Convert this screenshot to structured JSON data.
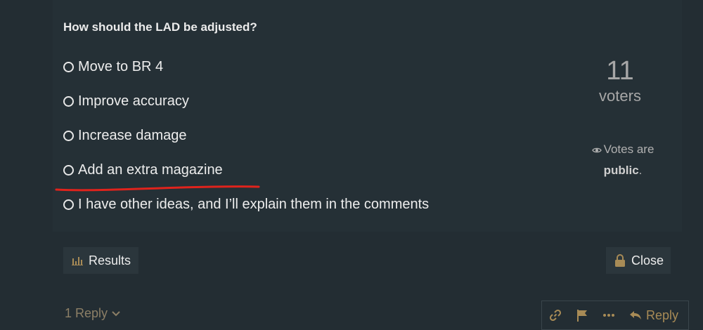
{
  "poll": {
    "question": "How should the LAD be adjusted?",
    "options": [
      {
        "label": "Move to BR 4"
      },
      {
        "label": "Improve accuracy"
      },
      {
        "label": "Increase damage"
      },
      {
        "label": "Add an extra magazine"
      },
      {
        "label": "I have other ideas, and I’ll explain them in the comments"
      }
    ],
    "voters_count": "11",
    "voters_label": "voters",
    "visibility_prefix": "Votes are",
    "visibility_value": "public",
    "visibility_suffix": ".",
    "results_label": "Results",
    "close_label": "Close"
  },
  "footer": {
    "replies_label": "1 Reply",
    "reply_label": "Reply"
  },
  "colors": {
    "background": "#232d33",
    "accent": "#a88b56",
    "annotation_red": "#e0231c"
  }
}
